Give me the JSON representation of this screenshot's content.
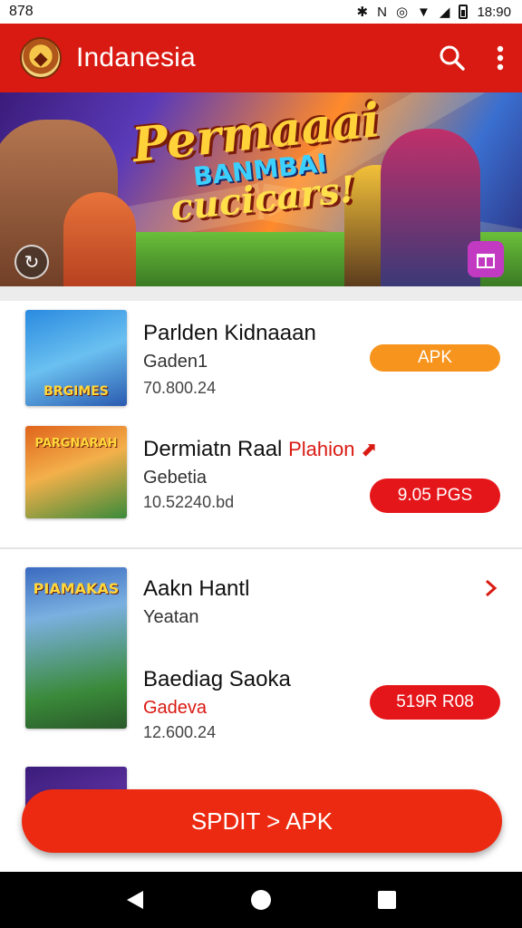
{
  "status_bar": {
    "time_left": "878",
    "clock": "18:90",
    "icons": [
      "bluetooth-icon",
      "nfc-icon",
      "vibrate-icon",
      "wifi-icon",
      "signal-icon",
      "battery-icon"
    ]
  },
  "app_bar": {
    "title": "Indanesia",
    "icons": [
      "app-logo-icon",
      "search-icon",
      "overflow-menu-icon"
    ]
  },
  "banner": {
    "line1": "Permaaai",
    "line2": "BANMBAI",
    "line3": "cucicars!",
    "icons": [
      "refresh-icon",
      "gift-icon"
    ]
  },
  "items": [
    {
      "thumb_label": "BRGIMES",
      "name": "Parlden Kidnaaan",
      "dev": "Gaden1",
      "meta": "70.800.24",
      "button": "APK"
    },
    {
      "thumb_label": "PARGNARAH",
      "name": "Dermiatn Raal",
      "tag": "Plahion",
      "dev": "Gebetia",
      "meta": "10.52240.bd",
      "button": "9.05 PGS"
    },
    {
      "thumb_label": "PIAMAKAS",
      "name": "Aakn Hantl",
      "dev": "Yeatan",
      "name2": "Baediag Saoka",
      "dev2": "Gadeva",
      "meta": "12.600.24",
      "button": "519R R08"
    },
    {
      "thumb_label": "",
      "name": ""
    }
  ],
  "colors": {
    "accent": "#d91a12",
    "orange": "#f7941d",
    "button_red": "#e5161a"
  },
  "fab": {
    "label": "SPDIT > APK"
  },
  "nav": {
    "icons": [
      "back-icon",
      "home-icon",
      "recents-icon"
    ]
  }
}
